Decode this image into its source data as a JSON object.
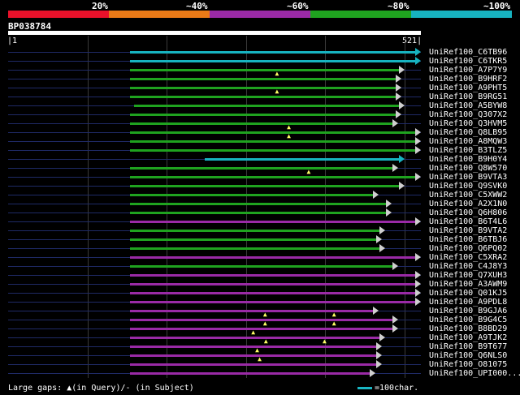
{
  "legend": {
    "colors": [
      "#e8112a",
      "#ea7a17",
      "#9a2aa6",
      "#1fa31f",
      "#17b3c0"
    ],
    "labels": [
      "20%",
      "~40%",
      "~60%",
      "~80%",
      "~100%"
    ]
  },
  "query": {
    "id": "BP038784",
    "start": "1",
    "end": "521"
  },
  "footer": {
    "gaps_text": "Large gaps: ▲(in Query)/- (in Subject)",
    "scale_text": "=100char."
  },
  "hits": [
    {
      "name": "UniRef100_C6TB96",
      "color": "#17b3c0",
      "start": 1,
      "end": 521,
      "gaps": []
    },
    {
      "name": "UniRef100_C6TKR5",
      "color": "#17b3c0",
      "start": 1,
      "end": 521,
      "gaps": []
    },
    {
      "name": "UniRef100_A7P7Y9",
      "color": "#1fa31f",
      "start": 1,
      "end": 500,
      "gaps": []
    },
    {
      "name": "UniRef100_B9HRF2",
      "color": "#1fa31f",
      "start": 1,
      "end": 496,
      "gaps": [
        340
      ]
    },
    {
      "name": "UniRef100_A9PHT5",
      "color": "#1fa31f",
      "start": 1,
      "end": 496,
      "gaps": []
    },
    {
      "name": "UniRef100_B9RG51",
      "color": "#1fa31f",
      "start": 1,
      "end": 496,
      "gaps": [
        340
      ]
    },
    {
      "name": "UniRef100_A5BYW8",
      "color": "#1fa31f",
      "start": 8,
      "end": 500,
      "gaps": []
    },
    {
      "name": "UniRef100_Q307X2",
      "color": "#1fa31f",
      "start": 1,
      "end": 496,
      "gaps": []
    },
    {
      "name": "UniRef100_Q3HVM5",
      "color": "#1fa31f",
      "start": 1,
      "end": 492,
      "gaps": []
    },
    {
      "name": "UniRef100_Q8LB95",
      "color": "#1fa31f",
      "start": 1,
      "end": 521,
      "gaps": [
        355
      ]
    },
    {
      "name": "UniRef100_A8MQW3",
      "color": "#1fa31f",
      "start": 1,
      "end": 521,
      "gaps": [
        355
      ]
    },
    {
      "name": "UniRef100_B3TLZ5",
      "color": "#1fa31f",
      "start": 1,
      "end": 521,
      "gaps": []
    },
    {
      "name": "UniRef100_B9H0Y4",
      "color": "#17b3c0",
      "start": 135,
      "end": 500,
      "gaps": []
    },
    {
      "name": "UniRef100_Q8W570",
      "color": "#1fa31f",
      "start": 1,
      "end": 492,
      "gaps": []
    },
    {
      "name": "UniRef100_B9VTA3",
      "color": "#1fa31f",
      "start": 1,
      "end": 521,
      "gaps": [
        380
      ]
    },
    {
      "name": "UniRef100_Q9SVK0",
      "color": "#1fa31f",
      "start": 1,
      "end": 500,
      "gaps": []
    },
    {
      "name": "UniRef100_C5XWW2",
      "color": "#1fa31f",
      "start": 1,
      "end": 468,
      "gaps": []
    },
    {
      "name": "UniRef100_A2X1N0",
      "color": "#1fa31f",
      "start": 1,
      "end": 484,
      "gaps": []
    },
    {
      "name": "UniRef100_Q6H806",
      "color": "#1fa31f",
      "start": 1,
      "end": 484,
      "gaps": []
    },
    {
      "name": "UniRef100_B6T4L6",
      "color": "#9a2aa6",
      "start": 1,
      "end": 521,
      "gaps": []
    },
    {
      "name": "UniRef100_B9VTA2",
      "color": "#1fa31f",
      "start": 1,
      "end": 476,
      "gaps": []
    },
    {
      "name": "UniRef100_B6TBJ6",
      "color": "#1fa31f",
      "start": 1,
      "end": 472,
      "gaps": []
    },
    {
      "name": "UniRef100_Q6PQ02",
      "color": "#1fa31f",
      "start": 1,
      "end": 476,
      "gaps": []
    },
    {
      "name": "UniRef100_C5XRA2",
      "color": "#9a2aa6",
      "start": 1,
      "end": 521,
      "gaps": []
    },
    {
      "name": "UniRef100_C4J8Y3",
      "color": "#1fa31f",
      "start": 1,
      "end": 492,
      "gaps": []
    },
    {
      "name": "UniRef100_Q7XUH3",
      "color": "#9a2aa6",
      "start": 1,
      "end": 521,
      "gaps": []
    },
    {
      "name": "UniRef100_A3AWM9",
      "color": "#9a2aa6",
      "start": 1,
      "end": 521,
      "gaps": []
    },
    {
      "name": "UniRef100_Q01KJ5",
      "color": "#9a2aa6",
      "start": 1,
      "end": 521,
      "gaps": []
    },
    {
      "name": "UniRef100_A9PDL8",
      "color": "#9a2aa6",
      "start": 1,
      "end": 521,
      "gaps": []
    },
    {
      "name": "UniRef100_B9GJA6",
      "color": "#9a2aa6",
      "start": 1,
      "end": 468,
      "gaps": []
    },
    {
      "name": "UniRef100_B9G4C5",
      "color": "#9a2aa6",
      "start": 1,
      "end": 492,
      "gaps": [
        325,
        412
      ]
    },
    {
      "name": "UniRef100_B8BD29",
      "color": "#9a2aa6",
      "start": 1,
      "end": 492,
      "gaps": [
        325,
        412
      ]
    },
    {
      "name": "UniRef100_A9TJK2",
      "color": "#9a2aa6",
      "start": 1,
      "end": 476,
      "gaps": [
        310
      ]
    },
    {
      "name": "UniRef100_B9T677",
      "color": "#9a2aa6",
      "start": 1,
      "end": 472,
      "gaps": [
        326,
        400
      ]
    },
    {
      "name": "UniRef100_Q6NLS0",
      "color": "#9a2aa6",
      "start": 1,
      "end": 472,
      "gaps": [
        315
      ]
    },
    {
      "name": "UniRef100_O81075",
      "color": "#9a2aa6",
      "start": 1,
      "end": 472,
      "gaps": [
        318
      ]
    },
    {
      "name": "UniRef100_UPI000...",
      "color": "#9a2aa6",
      "start": 1,
      "end": 464,
      "gaps": []
    }
  ]
}
